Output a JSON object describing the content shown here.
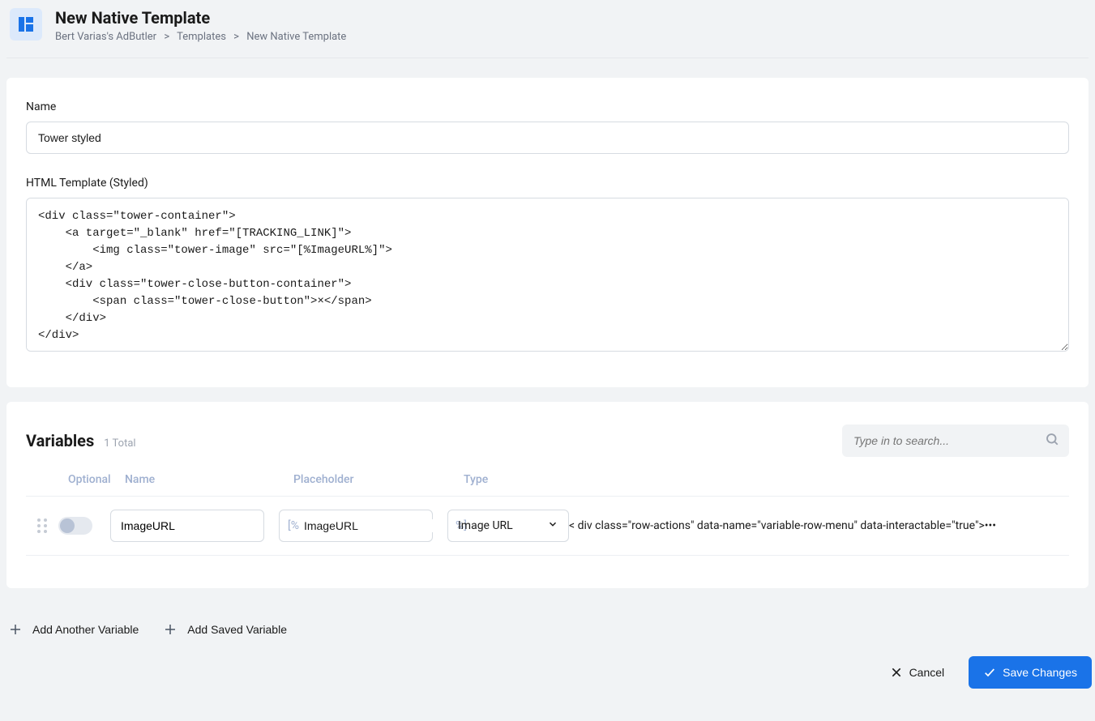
{
  "header": {
    "title": "New Native Template",
    "breadcrumb": {
      "root": "Bert Varias's AdButler",
      "mid": "Templates",
      "current": "New Native Template"
    }
  },
  "form": {
    "name_label": "Name",
    "name_value": "Tower styled",
    "html_label": "HTML Template (Styled)",
    "html_value": "<div class=\"tower-container\">\n    <a target=\"_blank\" href=\"[TRACKING_LINK]\">\n        <img class=\"tower-image\" src=\"[%ImageURL%]\">\n    </a>\n    <div class=\"tower-close-button-container\">\n        <span class=\"tower-close-button\">×</span>\n    </div>\n</div>"
  },
  "variables": {
    "title": "Variables",
    "count_text": "1 Total",
    "search_placeholder": "Type in to search...",
    "columns": {
      "optional": "Optional",
      "name": "Name",
      "placeholder": "Placeholder",
      "type": "Type"
    },
    "rows": [
      {
        "optional": false,
        "name": "ImageURL",
        "placeholder_prefix": "[%",
        "placeholder_value": "ImageURL",
        "placeholder_suffix": "%]",
        "type": "Image URL"
      }
    ],
    "add_another": "Add Another Variable",
    "add_saved": "Add Saved Variable"
  },
  "footer": {
    "cancel": "Cancel",
    "save": "Save Changes"
  }
}
